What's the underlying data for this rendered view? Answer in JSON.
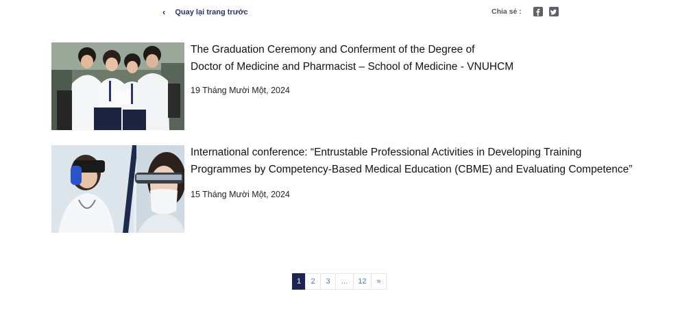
{
  "header": {
    "back_label": "Quay lại trang trước",
    "share_label": "Chia sẻ :",
    "share_icons": [
      "facebook-icon",
      "twitter-icon"
    ]
  },
  "articles": [
    {
      "title_lines": [
        "The Graduation Ceremony and Conferment of the Degree of",
        "Doctor of Medicine and Pharmacist – School of Medicine - VNUHCM"
      ],
      "date": "19 Tháng Mười Một, 2024"
    },
    {
      "title_lines": [
        "International conference: “Entrustable Professional Activities in Developing Training",
        "Programmes by Competency-Based Medical Education (CBME) and Evaluating Competence”"
      ],
      "date": "15 Tháng Mười Một, 2024"
    }
  ],
  "pagination": {
    "pages": [
      "1",
      "2",
      "3",
      "...",
      "12",
      "»"
    ],
    "current": "1"
  },
  "colors": {
    "accent": "#2a3466",
    "active_page": "#1e2452",
    "page_link": "#4a72b8"
  }
}
